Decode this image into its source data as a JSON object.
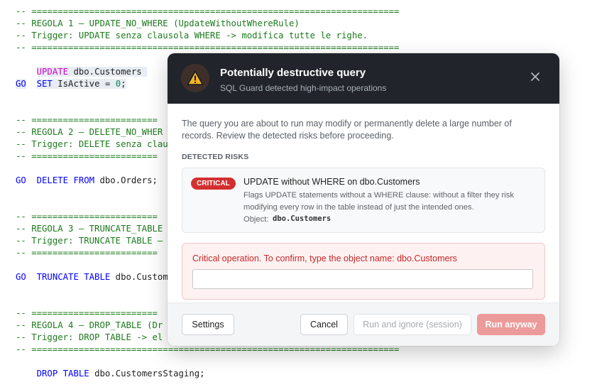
{
  "editor": {
    "lines": [
      "-- ======================================================================",
      "-- REGOLA 1 — UPDATE_NO_WHERE (UpdateWithoutWhereRule)",
      "-- Trigger: UPDATE senza clausola WHERE -> modifica tutte le righe.",
      "-- ======================================================================",
      "UPDATE dbo.Customers",
      "SET IsActive = 0;",
      "GO",
      "",
      "",
      "-- ========================",
      "-- REGOLA 2 — DELETE_NO_WHER",
      "-- Trigger: DELETE senza clau",
      "-- ========================",
      "DELETE FROM dbo.Orders;",
      "GO",
      "",
      "",
      "-- ========================",
      "-- REGOLA 3 — TRUNCATE_TABLE",
      "-- Trigger: TRUNCATE TABLE —",
      "-- ========================",
      "TRUNCATE TABLE dbo.Customers",
      "GO",
      "",
      "",
      "-- ========================",
      "-- REGOLA 4 — DROP_TABLE (Dr",
      "-- Trigger: DROP TABLE -> el",
      "-- ======================================================================",
      "DROP TABLE dbo.CustomersStaging;"
    ],
    "tokens": {
      "update_kw": "UPDATE",
      "update_obj": " dbo.Customers ",
      "set_kw": "SET",
      "set_rest": " IsActive = ",
      "set_num": "0",
      "set_end": ";",
      "go": "GO",
      "delete_kw": "DELETE FROM",
      "delete_obj": " dbo.Orders;",
      "truncate_kw": "TRUNCATE TABLE",
      "truncate_obj": " dbo.Customers",
      "drop_kw": "DROP TABLE",
      "drop_obj": " dbo.CustomersStaging;"
    }
  },
  "dialog": {
    "title": "Potentially destructive query",
    "subtitle": "SQL Guard detected high-impact operations",
    "intro": "The query you are about to run may modify or permanently delete a large number of records. Review the detected risks before proceeding.",
    "section_label": "DETECTED RISKS",
    "risk": {
      "badge": "CRITICAL",
      "title": "UPDATE without WHERE on dbo.Customers",
      "description": "Flags UPDATE statements without a WHERE clause: without a filter they risk modifying every row in the table instead of just the intended ones.",
      "object_label": "Object:",
      "object_value": "dbo.Customers"
    },
    "confirm": {
      "label": "Critical operation. To confirm, type the object name: dbo.Customers",
      "value": "",
      "placeholder": ""
    },
    "buttons": {
      "settings": "Settings",
      "cancel": "Cancel",
      "run_ignore": "Run and ignore (session)",
      "run_anyway": "Run anyway"
    }
  },
  "colors": {
    "header_bg": "#21252b",
    "critical": "#d32f2f",
    "run_anyway_bg": "#ec9a9a",
    "comment": "#1c7a1c",
    "keyword": "#0000ff"
  },
  "icons": {
    "header": "warning-icon",
    "close": "close-icon"
  }
}
